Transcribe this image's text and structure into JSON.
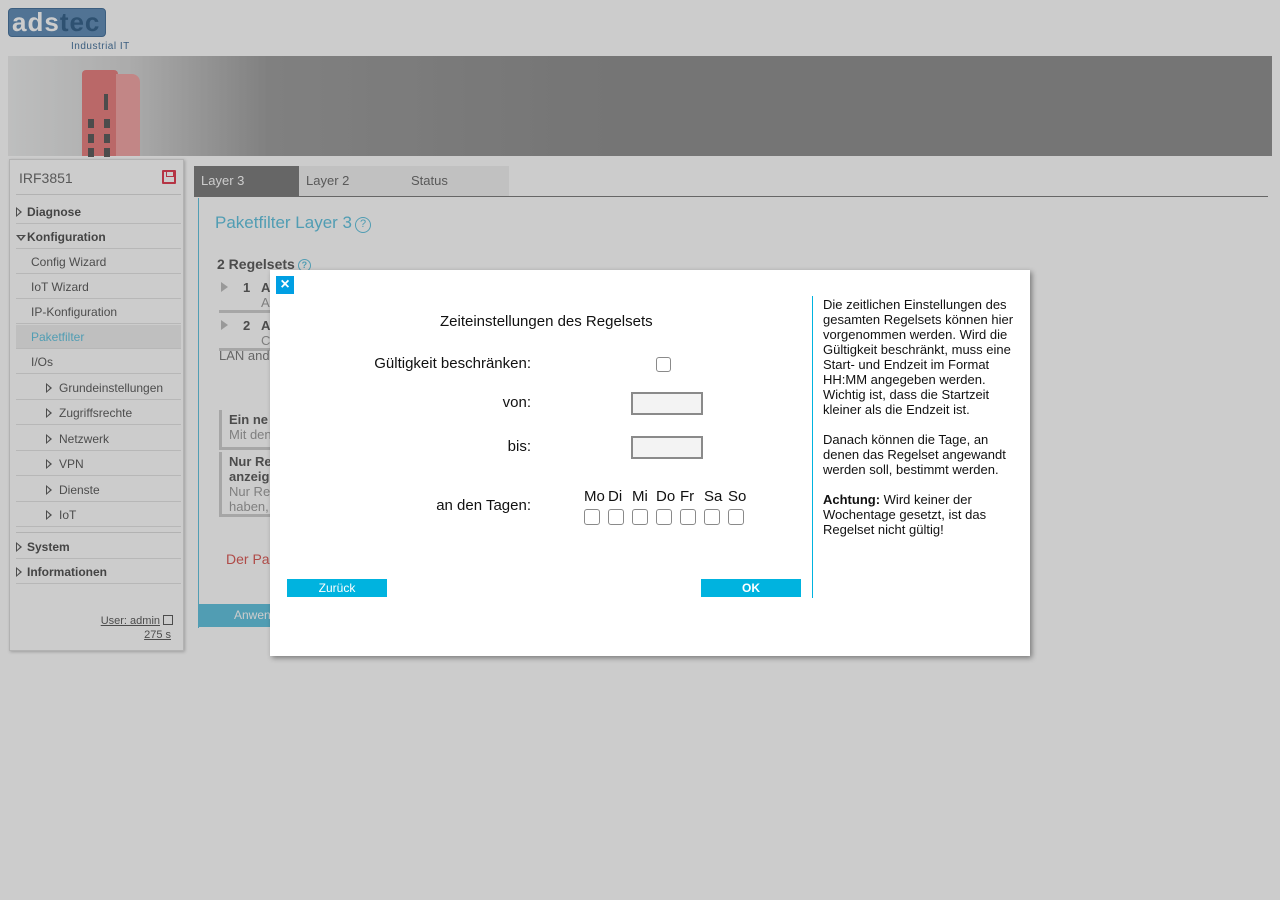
{
  "brand": {
    "logo_main": "ads",
    "logo_accent": "tec",
    "logo_sub": "Industrial IT"
  },
  "device": {
    "name": "IRF3851"
  },
  "sidebar": {
    "items": [
      {
        "label": "Diagnose",
        "expanded": false
      },
      {
        "label": "Konfiguration",
        "expanded": true
      }
    ],
    "config_items": [
      "Config Wizard",
      "IoT Wizard",
      "IP-Konfiguration",
      "Paketfilter",
      "I/Os"
    ],
    "active_item": "Paketfilter",
    "io_items": [
      "Grundeinstellungen",
      "Zugriffsrechte",
      "Netzwerk",
      "VPN",
      "Dienste",
      "IoT"
    ],
    "bottom_items": [
      "System",
      "Informationen"
    ],
    "user": "User: admin",
    "timer": "275 s"
  },
  "tabs": [
    "Layer 3",
    "Layer 2",
    "Status"
  ],
  "main": {
    "title": "Paketfilter Layer 3",
    "ruleset_count": "2 Regelsets",
    "rules": [
      {
        "num": "1",
        "letter": "A",
        "sub": "A"
      },
      {
        "num": "2",
        "letter": "A",
        "sub": "C"
      }
    ],
    "lan_and": "LAN and",
    "box1_title": "Ein ne",
    "box1_sub": "Mit den",
    "box2_title": "Nur Re",
    "box2_title2": "anzeig",
    "box2_sub": "Nur Rec",
    "box2_sub2": "haben,",
    "warning": "Der Pa",
    "apply": "Anwen"
  },
  "dialog": {
    "close_icon": "×",
    "title": "Zeiteinstellungen des Regelsets",
    "restrict_label": "Gültigkeit beschränken:",
    "restrict_checked": false,
    "from_label": "von:",
    "from_value": "",
    "to_label": "bis:",
    "to_value": "",
    "days_label": "an den Tagen:",
    "days": [
      "Mo",
      "Di",
      "Mi",
      "Do",
      "Fr",
      "Sa",
      "So"
    ],
    "back_button": "Zurück",
    "ok_button": "OK",
    "help_p1": "Die zeitlichen Einstellungen des gesamten Regelsets können hier vorgenommen werden. Wird die Gültigkeit beschränkt, muss eine Start- und Endzeit im Format HH:MM angegeben werden. Wichtig ist, dass die Startzeit kleiner als die Endzeit ist.",
    "help_p2": "Danach können die Tage, an denen das Regelset angewandt werden soll, bestimmt werden.",
    "help_p3_bold": "Achtung:",
    "help_p3": " Wird keiner der Wochentage gesetzt, ist das Regelset nicht gültig!"
  }
}
